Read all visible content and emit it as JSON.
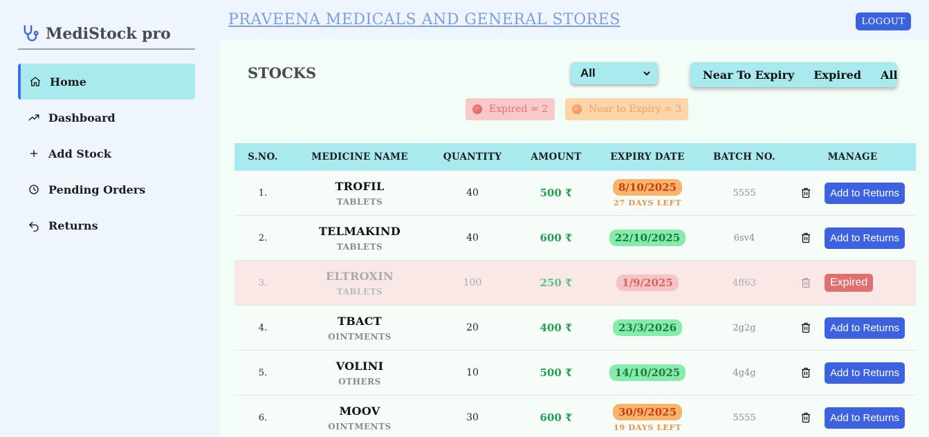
{
  "brand": {
    "name": "MediStock pro",
    "icon": "stethoscope-icon"
  },
  "sidebar": {
    "items": [
      {
        "label": "Home",
        "icon": "home-icon",
        "active": true
      },
      {
        "label": "Dashboard",
        "icon": "trending-up-icon",
        "active": false
      },
      {
        "label": "Add Stock",
        "icon": "plus-icon",
        "active": false
      },
      {
        "label": "Pending Orders",
        "icon": "clock-icon",
        "active": false
      },
      {
        "label": "Returns",
        "icon": "undo-icon",
        "active": false
      }
    ]
  },
  "header": {
    "store_name": "PRAVEENA MEDICALS AND GENERAL STORES",
    "logout_label": "LOGOUT"
  },
  "main": {
    "title": "STOCKS",
    "filter_select": {
      "value": "All"
    },
    "segment": [
      "Near To Expiry",
      "Expired",
      "All"
    ],
    "badges": {
      "expired": "Expired = 2",
      "near": "Near to Expiry = 3"
    }
  },
  "table": {
    "headers": [
      "S.NO.",
      "MEDICINE NAME",
      "QUANTITY",
      "AMOUNT",
      "EXPIRY DATE",
      "BATCH NO.",
      "MANAGE"
    ],
    "rows": [
      {
        "sno": "1.",
        "name": "TROFIL",
        "category": "TABLETS",
        "qty": "40",
        "amount": "500 ₹",
        "expiry": "8/10/2025",
        "status": "near",
        "days_left": "27 DAYS LEFT",
        "batch": "5555",
        "action": "Add to Returns"
      },
      {
        "sno": "2.",
        "name": "TELMAKIND",
        "category": "TABLETS",
        "qty": "40",
        "amount": "600 ₹",
        "expiry": "22/10/2025",
        "status": "ok",
        "days_left": "",
        "batch": "6sv4",
        "action": "Add to Returns"
      },
      {
        "sno": "3.",
        "name": "ELTROXIN",
        "category": "TABLETS",
        "qty": "100",
        "amount": "250 ₹",
        "expiry": "1/9/2025",
        "status": "expired",
        "days_left": "",
        "batch": "4ff63",
        "action": "Expired"
      },
      {
        "sno": "4.",
        "name": "TBACT",
        "category": "OINTMENTS",
        "qty": "20",
        "amount": "400 ₹",
        "expiry": "23/3/2026",
        "status": "ok",
        "days_left": "",
        "batch": "2g2g",
        "action": "Add to Returns"
      },
      {
        "sno": "5.",
        "name": "VOLINI",
        "category": "OTHERS",
        "qty": "10",
        "amount": "500 ₹",
        "expiry": "14/10/2025",
        "status": "ok",
        "days_left": "",
        "batch": "4g4g",
        "action": "Add to Returns"
      },
      {
        "sno": "6.",
        "name": "MOOV",
        "category": "OINTMENTS",
        "qty": "30",
        "amount": "600 ₹",
        "expiry": "30/9/2025",
        "status": "near",
        "days_left": "19 DAYS LEFT",
        "batch": "5555",
        "action": "Add to Returns"
      }
    ]
  },
  "colors": {
    "accent": "#3d62e0",
    "cyan": "#a9eaee",
    "expired": "#e07070",
    "near": "#f9b46c",
    "ok": "#86ecab"
  }
}
